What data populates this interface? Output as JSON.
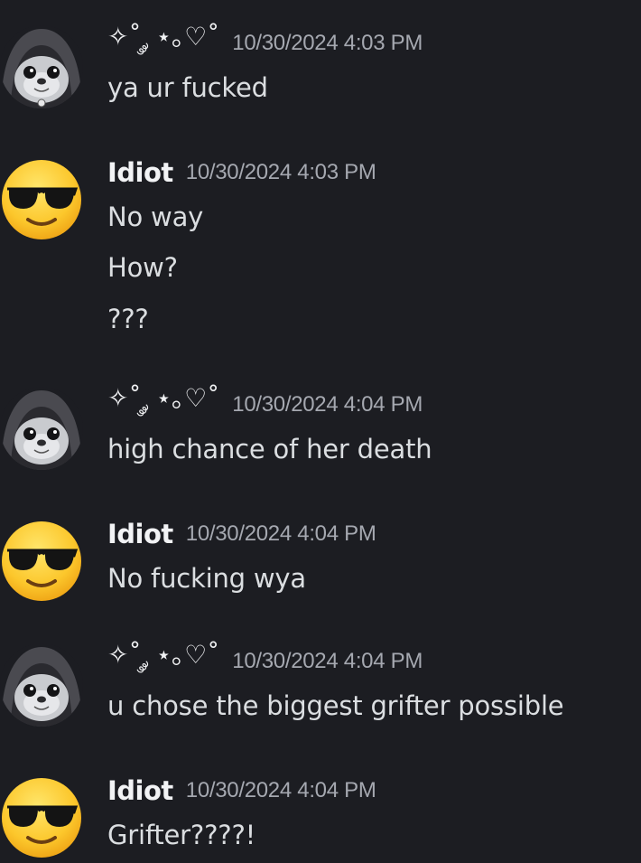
{
  "messages": [
    {
      "author": "✧˚ ༘ ⋆｡♡˚",
      "author_style": "deco",
      "avatar": "seal-hood-avatar",
      "timestamp": "10/30/2024 4:03 PM",
      "lines": [
        "ya ur fucked"
      ]
    },
    {
      "author": "Idiot",
      "author_style": "bold",
      "avatar": "sunglasses-emoji-avatar",
      "timestamp": "10/30/2024 4:03 PM",
      "lines": [
        "No way",
        "How?",
        "???"
      ]
    },
    {
      "author": "✧˚ ༘ ⋆｡♡˚",
      "author_style": "deco",
      "avatar": "seal-hood-avatar",
      "timestamp": "10/30/2024 4:04 PM",
      "lines": [
        "high chance of her death"
      ]
    },
    {
      "author": "Idiot",
      "author_style": "bold",
      "avatar": "sunglasses-emoji-avatar",
      "timestamp": "10/30/2024 4:04 PM",
      "lines": [
        "No fucking wya"
      ]
    },
    {
      "author": "✧˚ ༘ ⋆｡♡˚",
      "author_style": "deco",
      "avatar": "seal-hood-avatar",
      "timestamp": "10/30/2024 4:04 PM",
      "lines": [
        "u chose the biggest grifter possible"
      ]
    },
    {
      "author": "Idiot",
      "author_style": "bold",
      "avatar": "sunglasses-emoji-avatar",
      "timestamp": "10/30/2024 4:04 PM",
      "lines": [
        "Grifter????!"
      ]
    }
  ],
  "colors": {
    "background": "#1c1d22",
    "username": "#f2f3f5",
    "timestamp": "#a5a8b0",
    "message_text": "#dbdee1"
  }
}
